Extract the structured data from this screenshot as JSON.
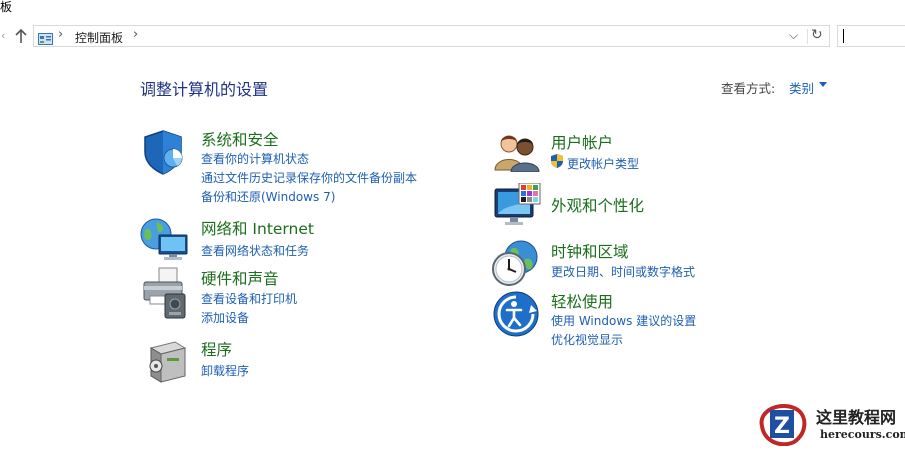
{
  "window": {
    "title_fragment": "板"
  },
  "address_bar": {
    "back_glyph": "‹",
    "separator": "›",
    "path": "控制面板",
    "dropdown_glyph": "⌵",
    "refresh_glyph": "↻"
  },
  "search": {
    "value": ""
  },
  "main": {
    "heading": "调整计算机的设置",
    "view_by_label": "查看方式:",
    "view_by_value": "类别"
  },
  "categories": {
    "system_security": {
      "title": "系统和安全",
      "links": [
        "查看你的计算机状态",
        "通过文件历史记录保存你的文件备份副本",
        "备份和还原(Windows 7)"
      ]
    },
    "network": {
      "title": "网络和 Internet",
      "links": [
        "查看网络状态和任务"
      ]
    },
    "hardware": {
      "title": "硬件和声音",
      "links": [
        "查看设备和打印机",
        "添加设备"
      ]
    },
    "programs": {
      "title": "程序",
      "links": [
        "卸载程序"
      ]
    },
    "user_accounts": {
      "title": "用户帐户",
      "links": [
        "更改帐户类型"
      ]
    },
    "appearance": {
      "title": "外观和个性化",
      "links": []
    },
    "clock_region": {
      "title": "时钟和区域",
      "links": [
        "更改日期、时间或数字格式"
      ]
    },
    "ease_of_access": {
      "title": "轻松使用",
      "links": [
        "使用 Windows 建议的设置",
        "优化视觉显示"
      ]
    }
  },
  "watermark": {
    "title": "这里教程网",
    "subtitle": "herecours.com",
    "logo_letter": "Z"
  },
  "colors": {
    "category_title": "#1c6e1c",
    "link": "#1e5fb4",
    "heading": "#1e3287"
  }
}
